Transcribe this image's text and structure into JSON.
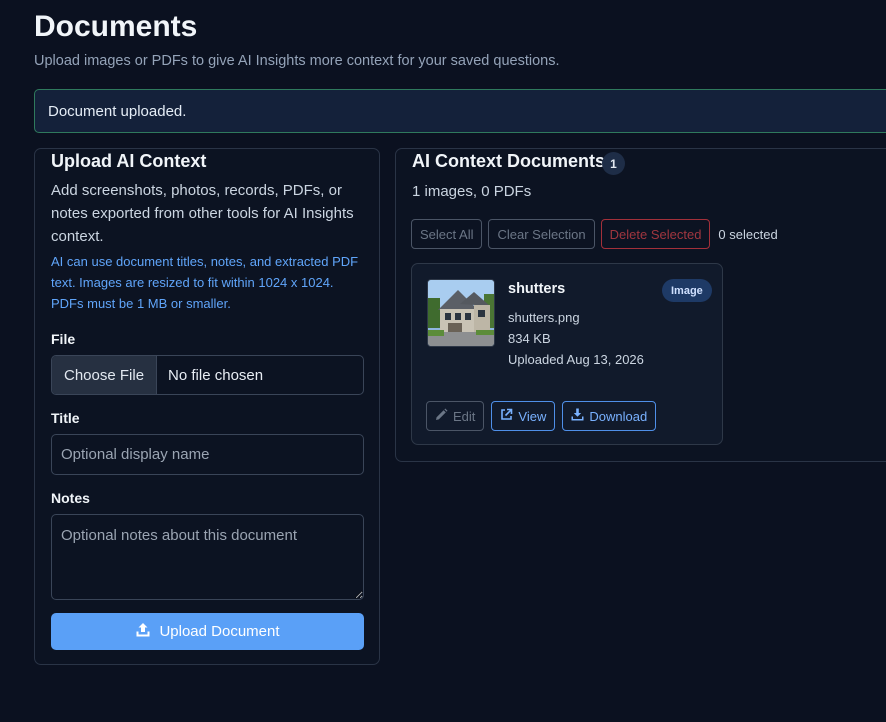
{
  "header": {
    "title": "Documents",
    "subtitle": "Upload images or PDFs to give AI Insights more context for your saved questions."
  },
  "alert": {
    "message": "Document uploaded."
  },
  "upload": {
    "title": "Upload AI Context",
    "description": "Add screenshots, photos, records, PDFs, or notes exported from other tools for AI Insights context.",
    "note": "AI can use document titles, notes, and extracted PDF text. Images are resized to fit within 1024 x 1024. PDFs must be 1 MB or smaller.",
    "file_label": "File",
    "choose_file_label": "Choose File",
    "file_status": "No file chosen",
    "title_label": "Title",
    "title_placeholder": "Optional display name",
    "notes_label": "Notes",
    "notes_placeholder": "Optional notes about this document",
    "upload_button": "Upload Document",
    "accent_color": "#5aa0f7"
  },
  "documents": {
    "title": "AI Context Documents",
    "count": "1",
    "summary": "1 images, 0 PDFs",
    "toolbar": {
      "select_all": "Select All",
      "clear_selection": "Clear Selection",
      "delete_selected": "Delete Selected",
      "selected_count": "0 selected"
    },
    "items": [
      {
        "name": "shutters",
        "type_badge": "Image",
        "filename": "shutters.png",
        "size": "834 KB",
        "uploaded": "Uploaded Aug 13, 2026",
        "actions": {
          "edit": "Edit",
          "view": "View",
          "download": "Download"
        },
        "thumbnail_icon": "house-photo"
      }
    ]
  }
}
